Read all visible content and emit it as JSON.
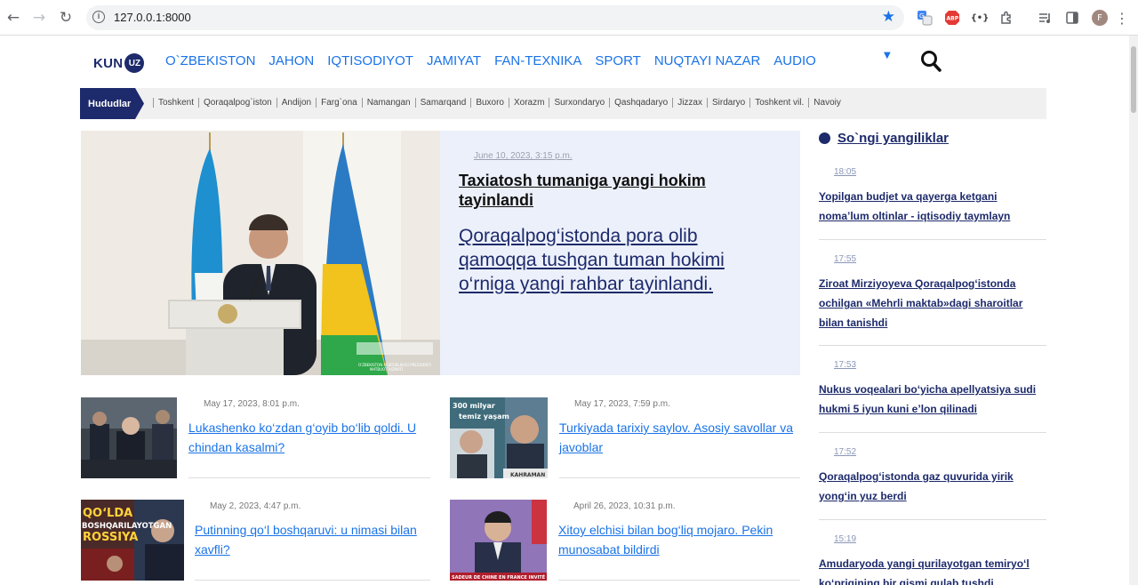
{
  "browser": {
    "url": "127.0.0.1:8000",
    "profile_initial": "F",
    "extensions": [
      "google-translate-icon",
      "adblock-icon",
      "json-viewer-icon",
      "extensions-puzzle-icon",
      "media-control-icon",
      "side-panel-icon",
      "profile-avatar",
      "menu-dots-icon"
    ]
  },
  "site": {
    "logo_text": "KUN",
    "logo_badge": "UZ",
    "nav": [
      "O`ZBEKISTON",
      "JAHON",
      "IQTISODIYOT",
      "JAMIYAT",
      "FAN-TEXNIKA",
      "SPORT",
      "NUQTAYI NAZAR",
      "AUDIO"
    ]
  },
  "regions": {
    "label": "Hududlar",
    "items": [
      "Toshkent",
      "Qoraqalpog`iston",
      "Andijon",
      "Farg`ona",
      "Namangan",
      "Samarqand",
      "Buxoro",
      "Xorazm",
      "Surxondaryo",
      "Qashqadaryo",
      "Jizzax",
      "Sirdaryo",
      "Toshkent vil.",
      "Navoiy"
    ]
  },
  "hero": {
    "date": "June 10, 2023, 3:15 p.m.",
    "title": "Taxiatosh tumaniga yangi hokim tayinlandi",
    "lead": "Qoraqalpog‘istonda pora olib qamoqqa tushgan tuman hokimi o‘rniga yangi rahbar tayinlandi.",
    "image_caption": "O'ZBEKISTON RESPUBLIKASI PREZIDENTI MATBUOT XIZMATI"
  },
  "articles": [
    {
      "date": "May 17, 2023, 8:01 p.m.",
      "title": "Lukashenko ko‘zdan g‘oyib bo‘lib qoldi. U chindan kasalmi?"
    },
    {
      "date": "May 17, 2023, 7:59 p.m.",
      "title": "Turkiyada tarixiy saylov. Asosiy savollar va javoblar",
      "thumb_text": "300 milyar temiz yaşam",
      "thumb_caption": "KAHRAMAN"
    },
    {
      "date": "May 2, 2023, 4:47 p.m.",
      "title": "Putinning qo‘l boshqaruvi: u nimasi bilan xavfli?",
      "thumb_text": "QO‘LDA BOSHQARILAYOTGAN ROSSIYA"
    },
    {
      "date": "April 26, 2023, 10:31 p.m.",
      "title": "Xitoy elchisi bilan bog‘liq mojaro. Pekin munosabat bildirdi",
      "thumb_caption": "SADEUR DE CHINE EN FRANCE INVITÉ DE LCI"
    }
  ],
  "sidebar": {
    "heading": "So`ngi yangiliklar",
    "items": [
      {
        "time": "18:05",
        "title": "Yopilgan budjet va qayerga ketgani noma’lum oltinlar - iqtisodiy taymlayn"
      },
      {
        "time": "17:55",
        "title": "Ziroat Mirziyoyeva Qoraqalpog‘istonda ochilgan «Mehrli maktab»dagi sharoitlar bilan tanishdi"
      },
      {
        "time": "17:53",
        "title": "Nukus voqealari bo‘yicha apellyatsiya sudi hukmi 5 iyun kuni e’lon qilinadi"
      },
      {
        "time": "17:52",
        "title": "Qoraqalpog‘istonda gaz quvurida yirik yong‘in yuz berdi"
      },
      {
        "time": "15:19",
        "title": "Amudaryoda yangi qurilayotgan temiryo‘l ko‘prigining bir qismi qulab tushdi"
      }
    ]
  },
  "colors": {
    "brand": "#1d2a6b",
    "link": "#1a73e8",
    "hero_bg": "#ecf0fa"
  }
}
